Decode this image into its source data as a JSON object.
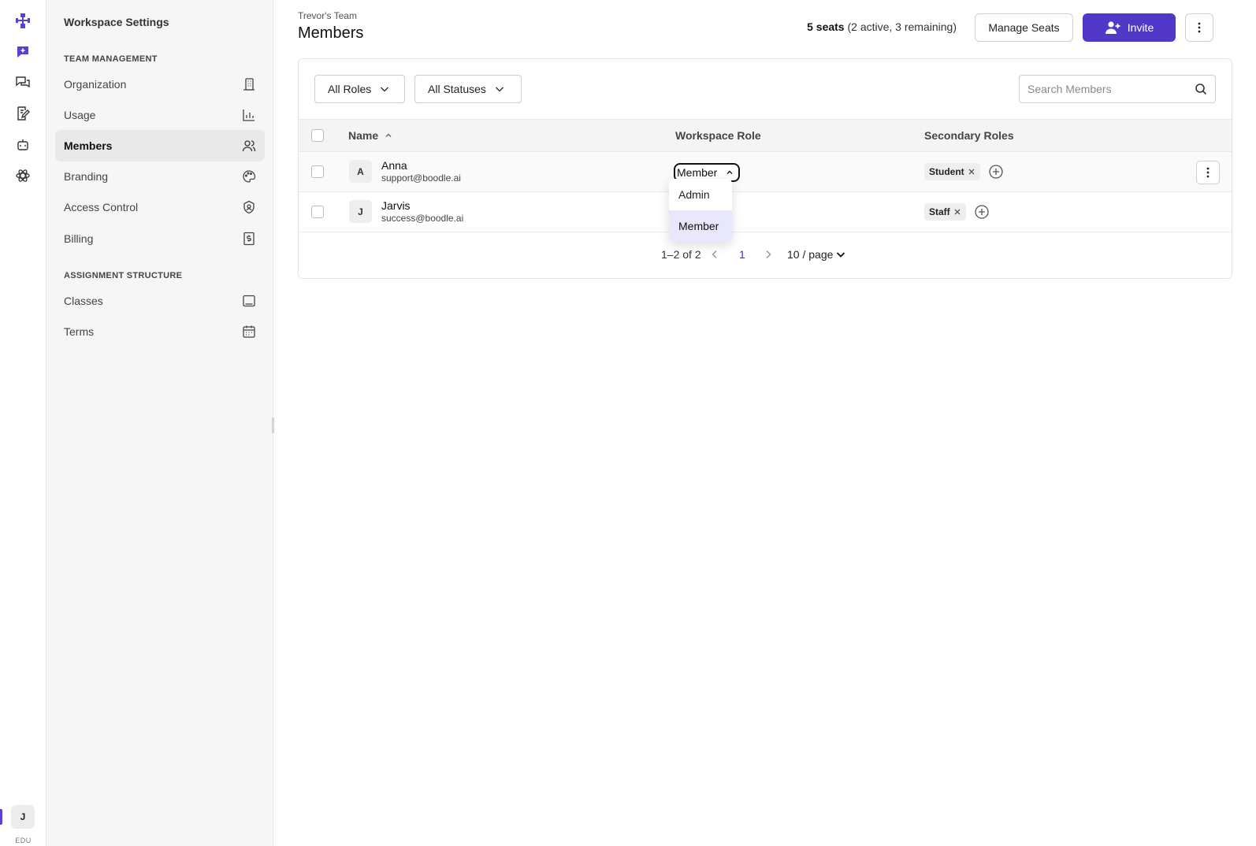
{
  "sidebar": {
    "title": "Workspace Settings",
    "sections": [
      {
        "label": "TEAM MANAGEMENT",
        "items": [
          {
            "label": "Organization",
            "icon": "building-icon"
          },
          {
            "label": "Usage",
            "icon": "chart-icon"
          },
          {
            "label": "Members",
            "icon": "users-icon",
            "active": true
          },
          {
            "label": "Branding",
            "icon": "palette-icon"
          },
          {
            "label": "Access Control",
            "icon": "shield-icon"
          },
          {
            "label": "Billing",
            "icon": "receipt-icon"
          }
        ]
      },
      {
        "label": "ASSIGNMENT STRUCTURE",
        "items": [
          {
            "label": "Classes",
            "icon": "tablet-icon"
          },
          {
            "label": "Terms",
            "icon": "calendar-icon"
          }
        ]
      }
    ]
  },
  "rail": {
    "user_initial": "J",
    "edu_label": "EDU",
    "accent": "#5b3fd6"
  },
  "header": {
    "breadcrumb": "Trevor's Team",
    "title": "Members",
    "seats_count": "5 seats",
    "seats_detail": " (2 active, 3 remaining)",
    "manage_seats_label": "Manage Seats",
    "invite_label": "Invite"
  },
  "filters": {
    "roles": "All Roles",
    "statuses": "All Statuses",
    "search_placeholder": "Search Members"
  },
  "table": {
    "columns": [
      "Name",
      "Workspace Role",
      "Secondary Roles"
    ],
    "rows": [
      {
        "initial": "A",
        "name": "Anna",
        "email": "support@boodle.ai",
        "role": "Member",
        "secondary": [
          "Student"
        ]
      },
      {
        "initial": "J",
        "name": "Jarvis",
        "email": "success@boodle.ai",
        "role": "Member",
        "secondary": [
          "Staff"
        ]
      }
    ]
  },
  "pagination": {
    "range": "1–2 of 2",
    "current_page": "1",
    "per_page": "10 / page"
  },
  "role_dropdown": {
    "options": [
      "Admin",
      "Member"
    ],
    "selected": "Member"
  },
  "colors": {
    "primary": "#5138c9",
    "selected_option_bg": "#e8e7fb"
  }
}
